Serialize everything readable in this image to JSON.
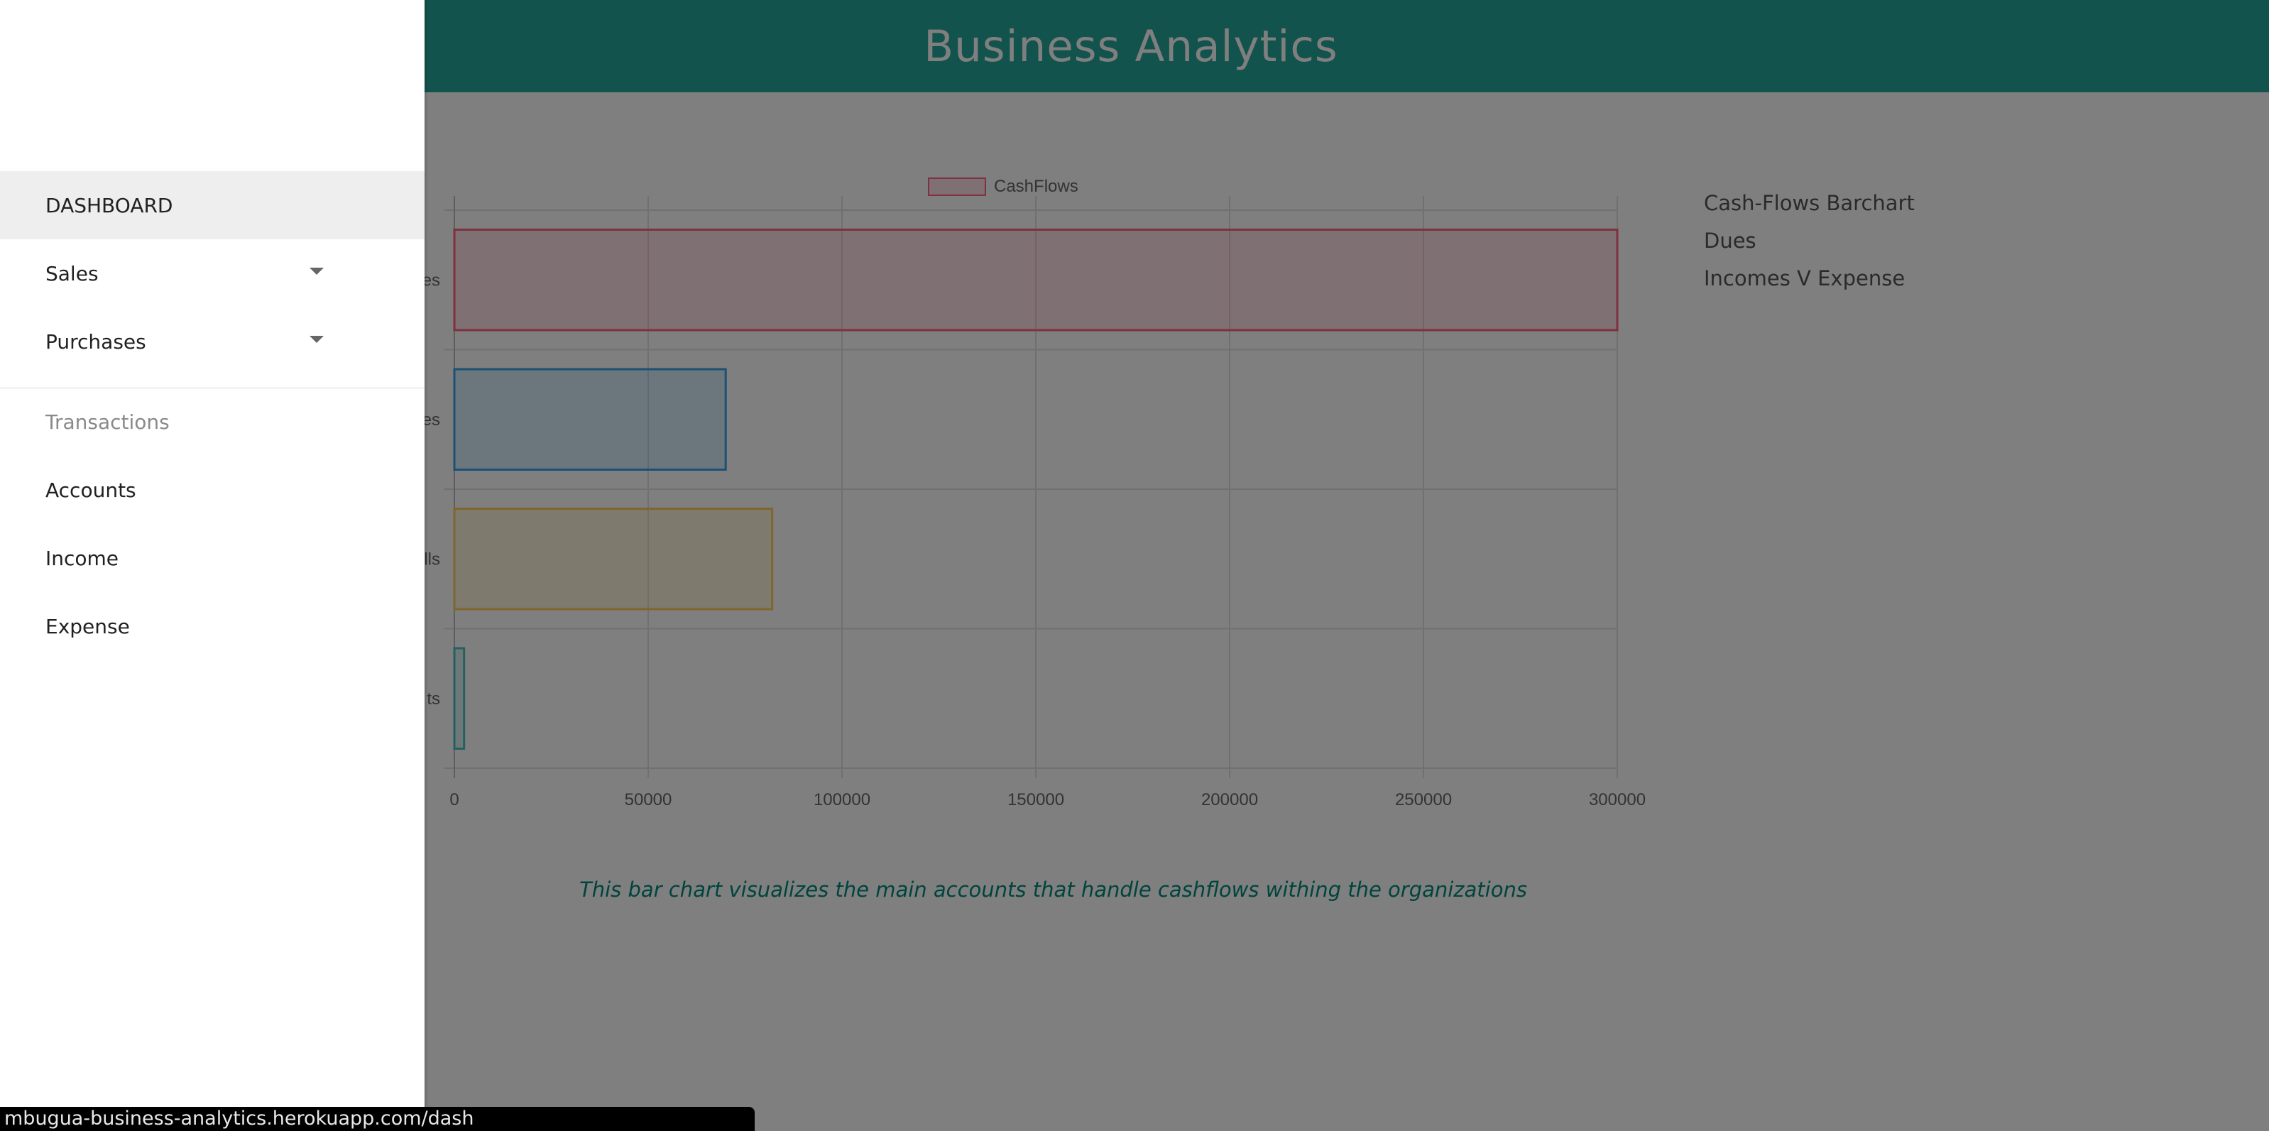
{
  "header": {
    "title": "Business Analytics"
  },
  "right_nav": {
    "items": [
      "Cash-Flows Barchart",
      "Dues",
      "Incomes V Expense"
    ]
  },
  "caption": "This bar chart visualizes the main accounts that handle cashflows withing the organizations",
  "sidebar": {
    "items": [
      {
        "label": "DASHBOARD",
        "active": true
      },
      {
        "label": "Sales",
        "dropdown": true
      },
      {
        "label": "Purchases",
        "dropdown": true
      }
    ],
    "section": {
      "label": "Transactions"
    },
    "section_items": [
      {
        "label": "Accounts"
      },
      {
        "label": "Income"
      },
      {
        "label": "Expense"
      }
    ]
  },
  "status_bar": {
    "url": "mbugua-business-analytics.herokuapp.com/dash"
  },
  "colors": {
    "header": "#26a69a",
    "caption": "#00897b"
  },
  "chart_data": {
    "type": "bar",
    "orientation": "horizontal",
    "legend": {
      "label": "CashFlows",
      "placement": "top"
    },
    "categories_visible": [
      "es",
      "es",
      "lls",
      "ts"
    ],
    "series": [
      {
        "name": "CashFlows",
        "values": [
          300000,
          70000,
          82000,
          2500
        ]
      }
    ],
    "bar_colors": [
      {
        "fill": "rgba(255,99,132,0.2)",
        "stroke": "rgba(255,99,132,1)"
      },
      {
        "fill": "rgba(54,162,235,0.2)",
        "stroke": "rgba(54,162,235,1)"
      },
      {
        "fill": "rgba(255,206,86,0.2)",
        "stroke": "rgba(255,206,86,1)"
      },
      {
        "fill": "rgba(75,192,192,0.2)",
        "stroke": "rgba(75,192,192,1)"
      }
    ],
    "x_ticks": [
      "0",
      "50000",
      "100000",
      "150000",
      "200000",
      "250000",
      "300000"
    ],
    "xlim": [
      0,
      300000
    ],
    "grid": true
  }
}
